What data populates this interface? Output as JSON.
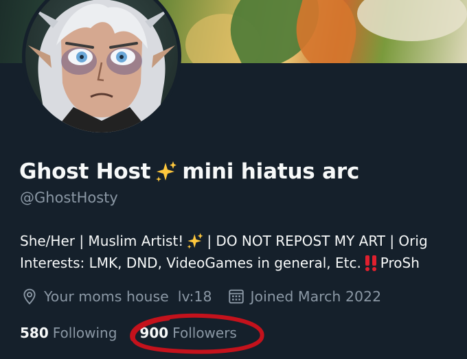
{
  "profile": {
    "display_name": "Ghost Host",
    "name_suffix": "mini hiatus arc",
    "handle": "@GhostHosty",
    "bio_line1_a": "She/Her | Muslim Artist!",
    "bio_line1_b": "| DO NOT REPOST MY ART | Orig",
    "bio_line2_a": "Interests: LMK, DND, VideoGames in general, Etc.",
    "bio_line2_b": "ProSh"
  },
  "meta": {
    "location": "Your moms house  lv:18",
    "joined": "Joined March 2022"
  },
  "stats": {
    "following_count": "580",
    "following_label": "Following",
    "followers_count": "900",
    "followers_label": "Followers"
  },
  "icons": {
    "name_emoji": "sparkles-icon",
    "bio_emoji_1": "sparkles-icon",
    "bio_emoji_2": "double-exclamation-icon",
    "location": "map-pin-icon",
    "joined": "calendar-icon"
  },
  "colors": {
    "background": "#15202b",
    "primary_text": "#f7f9f9",
    "secondary_text": "#8b98a5",
    "sparkle": "#ffc83d",
    "exclamation": "#e0202e",
    "annotation_circle": "#c4121c"
  }
}
